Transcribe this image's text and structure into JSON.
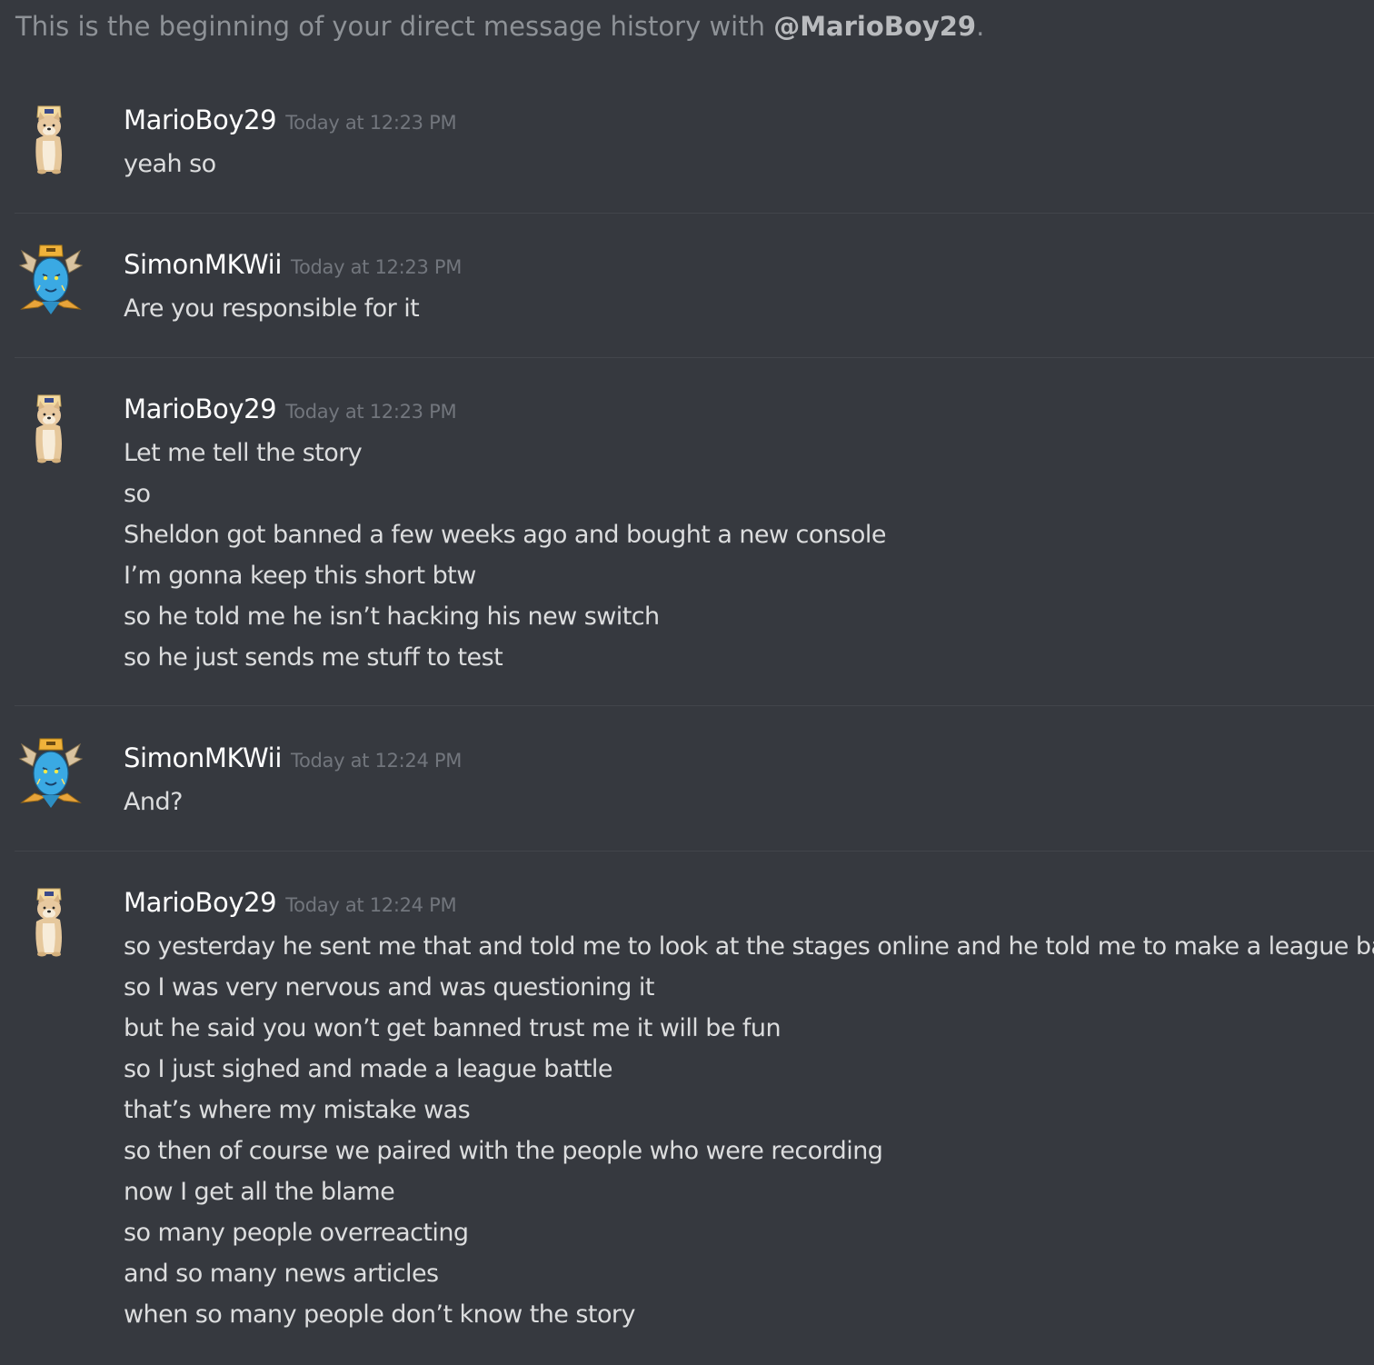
{
  "intro": {
    "prefix": "This is the beginning of your direct message history with ",
    "mention": "@MarioBoy29",
    "suffix": "."
  },
  "messages": [
    {
      "author": "MarioBoy29",
      "timestamp": "Today at 12:23 PM",
      "avatar_icon": "shiba-dog-avatar-icon",
      "lines": [
        "yeah so"
      ]
    },
    {
      "author": "SimonMKWii",
      "timestamp": "Today at 12:23 PM",
      "avatar_icon": "blue-face-avatar-icon",
      "lines": [
        "Are you responsible for it"
      ]
    },
    {
      "author": "MarioBoy29",
      "timestamp": "Today at 12:23 PM",
      "avatar_icon": "shiba-dog-avatar-icon",
      "lines": [
        "Let me tell the story",
        "so",
        "Sheldon got banned a few weeks ago and bought a new console",
        "I’m gonna keep this short btw",
        "so he told me he isn’t hacking his new switch",
        "so he just sends me stuff to test"
      ]
    },
    {
      "author": "SimonMKWii",
      "timestamp": "Today at 12:24 PM",
      "avatar_icon": "blue-face-avatar-icon",
      "lines": [
        "And?"
      ]
    },
    {
      "author": "MarioBoy29",
      "timestamp": "Today at 12:24 PM",
      "avatar_icon": "shiba-dog-avatar-icon",
      "lines": [
        "so yesterday he sent me that and told me to look at the stages online and he told me to make a league battle",
        "so I was very nervous and was questioning it",
        "but he said you won’t get banned trust me it will be fun",
        "so I just sighed and made a league battle",
        "that’s where my mistake was",
        "so then of course we paired with the people who were recording",
        "now I get all the blame",
        "so many people overreacting",
        "and so many news articles",
        "when so many people don’t know the story"
      ]
    }
  ]
}
